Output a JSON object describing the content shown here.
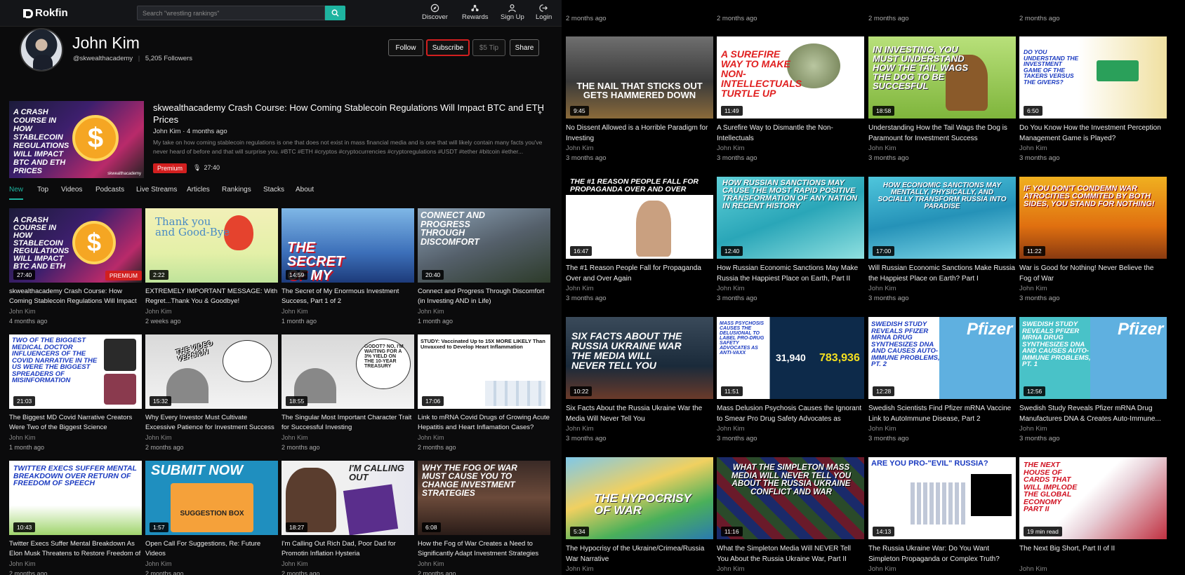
{
  "header": {
    "logo": "Rokfin",
    "search_placeholder": "Search \"wrestling rankings\"",
    "nav": [
      {
        "label": "Discover",
        "icon": "compass-icon"
      },
      {
        "label": "Rewards",
        "icon": "rewards-icon"
      },
      {
        "label": "Sign Up",
        "icon": "user-icon"
      },
      {
        "label": "Login",
        "icon": "login-icon"
      }
    ]
  },
  "profile": {
    "name": "John Kim",
    "handle": "@skwealthacademy",
    "followers": "5,205 Followers",
    "buttons": {
      "follow": "Follow",
      "subscribe": "Subscribe",
      "tip": "$5 Tip",
      "share": "Share"
    }
  },
  "featured": {
    "title": "skwealthacademy Crash Course: How Coming Stablecoin Regulations Will Impact BTC and ETH Prices",
    "meta": "John Kim · 4 months ago",
    "description": "My take on how coming stablecoin regulations is one that does not exist in mass financial media and is one that will likely contain many facts you've never heard of before and that will surprise you. #BTC #ETH #cryptos #cryptocurrencies #cryptoregulations #USDT #tether #bitcoin #ether...",
    "badge": "Premium",
    "duration": "27:40",
    "thumb_text": "A CRASH COURSE IN HOW STABLECOIN REGULATIONS WILL IMPACT BTC AND ETH PRICES",
    "watermark": "skwealthacademy"
  },
  "tabs": [
    "New",
    "Top",
    "Videos",
    "Podcasts",
    "Live Streams",
    "Articles",
    "Rankings",
    "Stacks",
    "About"
  ],
  "left_videos": [
    {
      "title": "skwealthacademy Crash Course: How Coming Stablecoin Regulations Will Impact BTC and...",
      "author": "John Kim",
      "date": "4 months ago",
      "duration": "27:40",
      "premium": "PREMIUM",
      "thumb": "A CRASH COURSE IN HOW STABLECOIN REGULATIONS WILL IMPACT BTC AND ETH"
    },
    {
      "title": "EXTREMELY IMPORTANT MESSAGE: With Regret...Thank You & Goodbye!",
      "author": "John Kim",
      "date": "2 weeks ago",
      "duration": "2:22",
      "thumb": "Thank you and Good-Bye"
    },
    {
      "title": "The Secret of My Enormous Investment Success, Part 1 of 2",
      "author": "John Kim",
      "date": "1 month ago",
      "duration": "14:59",
      "thumb": "THE SECRET OF MY SUCCESS"
    },
    {
      "title": "Connect and Progress Through Discomfort (in Investing AND in Life)",
      "author": "John Kim",
      "date": "1 month ago",
      "duration": "20:40",
      "thumb": "CONNECT AND PROGRESS THROUGH DISCOMFORT"
    },
    {
      "title": "The Biggest MD Covid Narrative Creators Were Two of the Biggest Science Misinformation...",
      "author": "John Kim",
      "date": "1 month ago",
      "duration": "21:03",
      "thumb": "TWO OF THE BIGGEST MEDICAL DOCTOR INFLUENCERS OF THE COVID NARRATIVE IN THE US WERE THE BIGGEST SPREADERS OF MISINFORMATION"
    },
    {
      "title": "Why Every Investor Must Cultivate Excessive Patience for Investment Success",
      "author": "John Kim",
      "date": "2 months ago",
      "duration": "15:32",
      "thumb": "THE VIDEO VERSION"
    },
    {
      "title": "The Singular Most Important Character Trait for Successful Investing",
      "author": "John Kim",
      "date": "2 months ago",
      "duration": "18:55",
      "thumb": "GODOT? NO, I'M WAITING FOR A 3% YIELD ON THE 10-YEAR TREASURY"
    },
    {
      "title": "Link to mRNA Covid Drugs of Growing Acute Hepatitis and Heart Inflamation Cases?",
      "author": "John Kim",
      "date": "2 months ago",
      "duration": "17:06",
      "thumb": "STUDY: Vaccinated Up to 15X MORE LIKELY Than Unvaxxed to Develop Heart Inflammation"
    },
    {
      "title": "Twitter Execs Suffer Mental Breakdown As Elon Musk Threatens to Restore Freedom of Speech",
      "author": "John Kim",
      "date": "2 months ago",
      "duration": "10:43",
      "thumb": "TWITTER EXECS SUFFER MENTAL BREAKDOWN OVER RETURN OF FREEDOM OF SPEECH"
    },
    {
      "title": "Open Call For Suggestions, Re: Future Videos",
      "author": "John Kim",
      "date": "2 months ago",
      "duration": "1:57",
      "thumb": "SUBMIT NOW"
    },
    {
      "title": "I'm Calling Out Rich Dad, Poor Dad for Promotin Inflation Hysteria",
      "author": "John Kim",
      "date": "2 months ago",
      "duration": "18:27",
      "thumb": "I'M CALLING OUT"
    },
    {
      "title": "How the Fog of War Creates a Need to Significantly Adapt Investment Strategies",
      "author": "John Kim",
      "date": "2 months ago",
      "duration": "6:08",
      "thumb": "WHY THE FOG OF WAR MUST CAUSE YOU TO CHANGE INVESTMENT STRATEGIES"
    }
  ],
  "right_top_dates": [
    "2 months ago",
    "2 months ago",
    "2 months ago",
    "2 months ago"
  ],
  "right_videos": [
    {
      "title": "No Dissent Allowed is a Horrible Paradigm for Investing",
      "author": "John Kim",
      "date": "3 months ago",
      "duration": "9:45",
      "thumb": "THE NAIL THAT STICKS OUT GETS HAMMERED DOWN"
    },
    {
      "title": "A Surefire Way to Dismantle the Non-Intellectuals",
      "author": "John Kim",
      "date": "3 months ago",
      "duration": "11:49",
      "thumb": "A SUREFIRE WAY TO MAKE NON-INTELLECTUALS TURTLE UP"
    },
    {
      "title": "Understanding How the Tail Wags the Dog is Paramount for Investment Success",
      "author": "John Kim",
      "date": "3 months ago",
      "duration": "18:58",
      "thumb": "IN INVESTING, YOU MUST UNDERSTAND HOW THE TAIL WAGS THE DOG TO BE SUCCESFUL"
    },
    {
      "title": "Do You Know How the Investment Perception Management Game is Played?",
      "author": "John Kim",
      "date": "3 months ago",
      "duration": "6:50",
      "thumb": "DO YOU UNDERSTAND THE INVESTMENT GAME OF THE TAKERS VERSUS THE GIVERS?"
    },
    {
      "title": "The #1 Reason People Fall for Propaganda Over and Over Again",
      "author": "John Kim",
      "date": "3 months ago",
      "duration": "16:47",
      "thumb": "THE #1 REASON PEOPLE FALL FOR PROPAGANDA OVER AND OVER"
    },
    {
      "title": "How Russian Economic Sanctions May Make Russia the Happiest Place on Earth, Part II",
      "author": "John Kim",
      "date": "3 months ago",
      "duration": "12:40",
      "thumb": "HOW RUSSIAN SANCTIONS MAY CAUSE THE MOST RAPID POSITIVE TRANSFORMATION OF ANY NATION IN RECENT HISTORY"
    },
    {
      "title": "Will Russian Economic Sanctions Make Russia the Happiest Place on Earth? Part I",
      "author": "John Kim",
      "date": "3 months ago",
      "duration": "17:00",
      "thumb": "HOW ECONOMIC SANCTIONS MAY MENTALLY, PHYSICALLY, AND SOCIALLY TRANSFORM RUSSIA INTO PARADISE"
    },
    {
      "title": "War is Good for Nothing! Never Believe the Fog of War",
      "author": "John Kim",
      "date": "3 months ago",
      "duration": "11:22",
      "thumb": "IF YOU DON'T CONDEMN WAR ATROCITIES COMMITED BY BOTH SIDES, YOU STAND FOR NOTHING!"
    },
    {
      "title": "Six Facts About the Russia Ukraine War the Media Will Never Tell You",
      "author": "John Kim",
      "date": "3 months ago",
      "duration": "10:22",
      "thumb": "SIX FACTS ABOUT THE RUSSIA UKRAINE WAR THE MEDIA WILL NEVER TELL YOU"
    },
    {
      "title": "Mass Delusion Psychosis Causes the Ignorant to Smear Pro Drug Safety Advocates as \"Anti-...",
      "author": "John Kim",
      "date": "3 months ago",
      "duration": "11:51",
      "thumb": "MASS PSYCHOSIS CAUSES THE DELUSIONAL TO LABEL PRO-DRUG SAFETY ADVOCATES AS ANTI-VAXX"
    },
    {
      "title": "Swedish Scientists Find Pfizer mRNA Vaccine Link to AutoImmune Disease, Part 2",
      "author": "John Kim",
      "date": "3 months ago",
      "duration": "12:28",
      "thumb": "SWEDISH STUDY REVEALS PFIZER mRNA DRUG SYNTHESIZES DNA AND CAUSES AUTO-IMMUNE PROBLEMS, PT. 2"
    },
    {
      "title": "Swedish Study Reveals Pfizer mRNA Drug Manufactures DNA & Creates Auto-Immune...",
      "author": "John Kim",
      "date": "3 months ago",
      "duration": "12:56",
      "thumb": "SWEDISH STUDY REVEALS PFIZER mRNA DRUG SYNTHESIZES DNA AND CAUSES AUTO-IMMUNE PROBLEMS, PT. 1"
    },
    {
      "title": "The Hypocrisy of the Ukraine/Crimea/Russia War Narrative",
      "author": "John Kim",
      "date": "",
      "duration": "5:34",
      "thumb": "THE HYPOCRISY OF WAR"
    },
    {
      "title": "What the Simpleton Media Will NEVER Tell You About the Russia Ukraine War, Part II",
      "author": "John Kim",
      "date": "",
      "duration": "11:16",
      "thumb": "WHAT THE SIMPLETON MASS MEDIA WILL NEVER TELL YOU ABOUT THE RUSSIA UKRAINE CONFLICT AND WAR"
    },
    {
      "title": "The Russia Ukraine War: Do You Want Simpleton Propaganda or Complex Truth?",
      "author": "John Kim",
      "date": "",
      "duration": "14:13",
      "thumb": "ARE YOU PRO-\"EVIL\" RUSSIA?"
    },
    {
      "title": "The Next Big Short, Part II of II",
      "author": "John Kim",
      "date": "",
      "duration": "19 min read",
      "thumb": "THE NEXT HOUSE OF CARDS THAT WILL IMPLODE THE GLOBAL ECONOMY PART II"
    }
  ],
  "colors": {
    "accent": "#1eb4a0",
    "premium": "#d21f1f"
  }
}
